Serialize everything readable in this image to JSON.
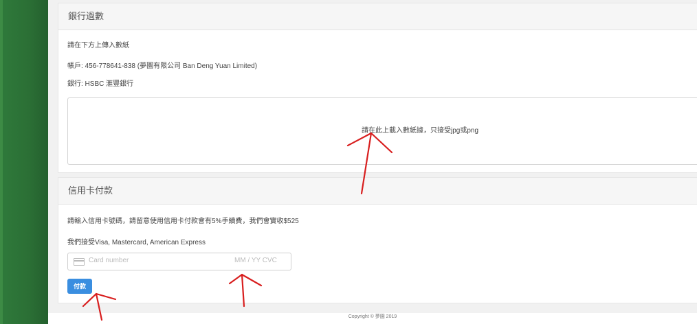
{
  "bank_section": {
    "title": "銀行過數",
    "instruction": "請在下方上傳入數紙",
    "account": "帳戶: 456-778641-838 (夢園有限公司 Ban Deng Yuan Limited)",
    "bank": "銀行: HSBC 滙豐銀行",
    "upload_hint": "請在此上載入數紙據，只接受jpg或png"
  },
  "card_section": {
    "title": "信用卡付款",
    "notice": "請輸入信用卡號碼，請留意使用信用卡付款會有5%手續費，我們會實收$525",
    "accepted": "我們接受Visa, Mastercard, American Express",
    "card_placeholder": "Card number",
    "expiry_placeholder": "MM / YY  CVC",
    "pay_label": "付款"
  },
  "footer": {
    "copyright": "Copyright © 夢園 2019"
  },
  "colors": {
    "sidebar": "#2b6f35",
    "accent_button": "#3a8ee0",
    "annotation": "#d81e1e"
  }
}
